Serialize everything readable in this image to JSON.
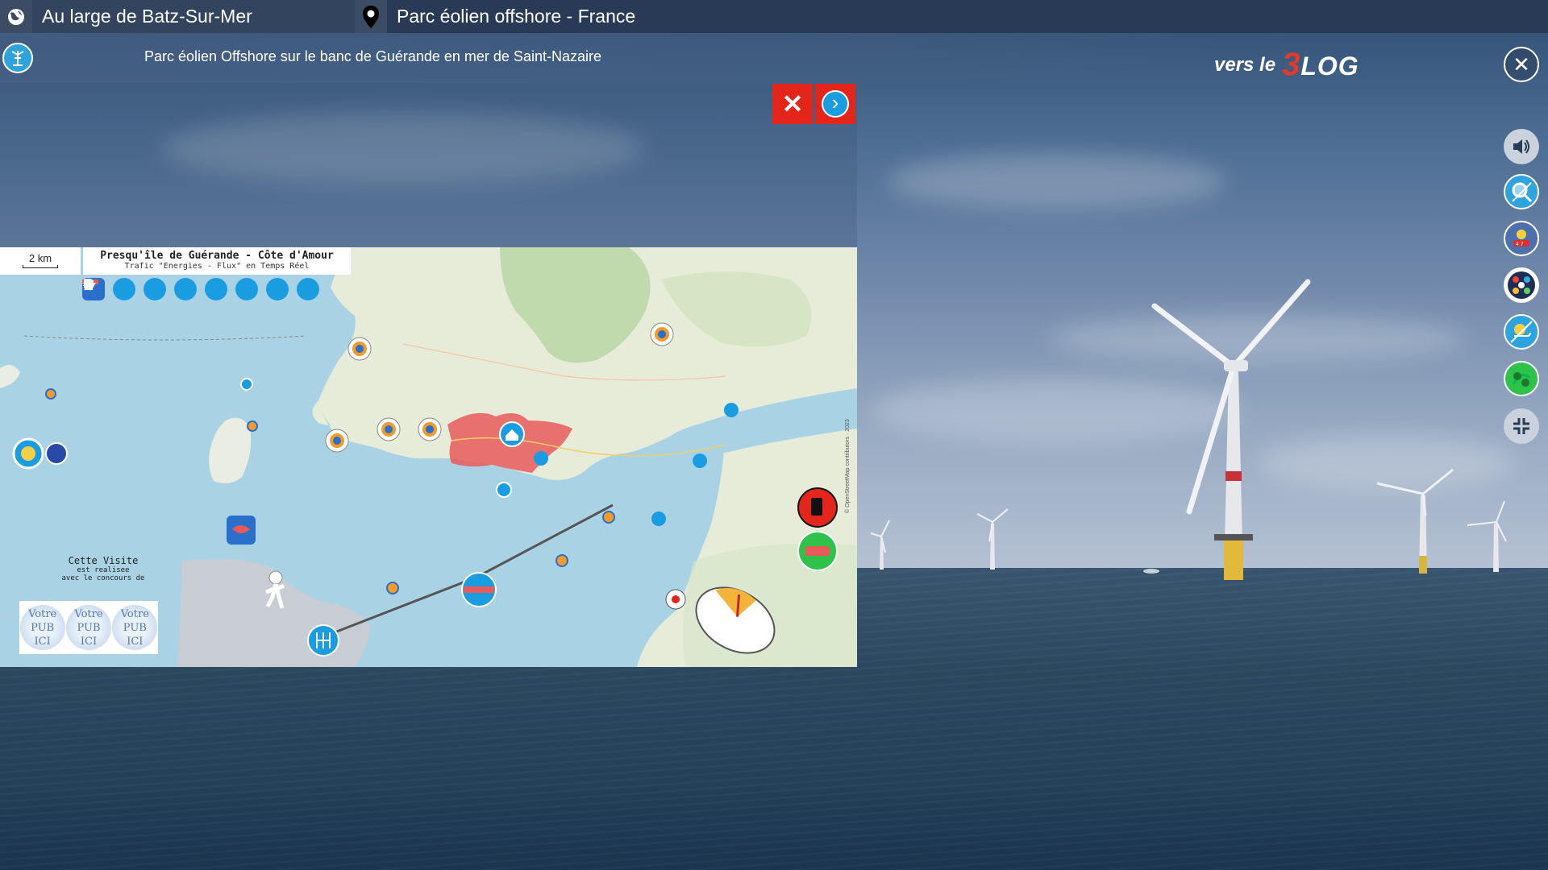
{
  "topbar": {
    "location_label": "Au large de Batz-Sur-Mer",
    "location_icon": "globe-icon",
    "place_label": "Parc éolien offshore - France",
    "place_icon": "map-pin-icon"
  },
  "subbar": {
    "description": "Parc éolien Offshore sur le banc de Guérande en mer de Saint-Nazaire",
    "blog_prefix": "vers le",
    "blog_brand_3": "3",
    "blog_brand_rest": "LOG",
    "close_glyph": "✕"
  },
  "right_toolbar": [
    "sound-icon",
    "search-magnifier-icon",
    "weather-icon",
    "layers-grid-icon",
    "weather-satellite-icon",
    "route-green-icon",
    "collapse-fullscreen-icon"
  ],
  "panel": {
    "close_glyph": "✕",
    "next_glyph": "›",
    "colors": {
      "close_bg": "#e4251b",
      "next_bg": "#e4251b",
      "next_inner": "#1a9ce0"
    }
  },
  "map": {
    "scale_label": "2 km",
    "title": "Presqu'île de Guérande - Côte d'Amour",
    "subtitle": "Trafic \"Energies - Flux\" en Temps Réel",
    "layer_icons": [
      "flag-icon",
      "wind-turbine-icon",
      "pipeline-icon",
      "energy-icon",
      "train-icon",
      "ship-icon",
      "plane-icon",
      "bus-icon"
    ],
    "visit_label": "Cette Visite",
    "visit_line2": "est realisee",
    "visit_line3": "avec le concours de",
    "pub_line1": "Votre",
    "pub_line2": "PUB",
    "pub_line3": "ICI",
    "legal": "© OpenStreetMap contributors · 2023"
  }
}
